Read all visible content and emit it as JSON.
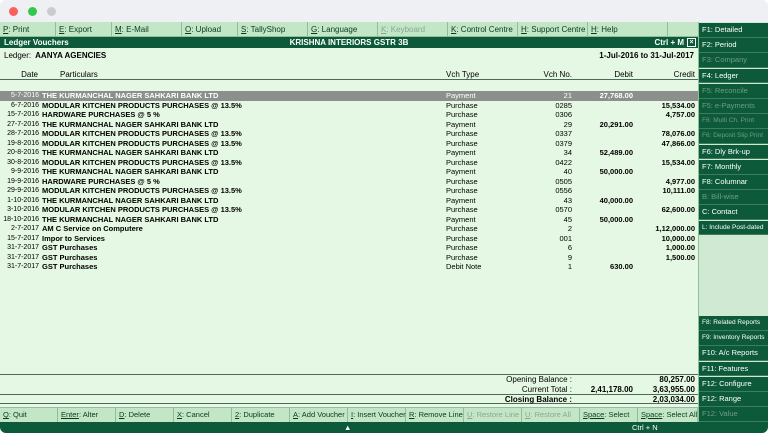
{
  "topbar": [
    {
      "key": "P",
      "label": ": Print",
      "w": 56,
      "disabled": false
    },
    {
      "key": "E",
      "label": ": Export",
      "w": 56,
      "disabled": false
    },
    {
      "key": "M",
      "label": ": E-Mail",
      "w": 70,
      "disabled": false
    },
    {
      "key": "O",
      "label": ": Upload",
      "w": 56,
      "disabled": false
    },
    {
      "key": "S",
      "label": ": TallyShop",
      "w": 70,
      "disabled": false
    },
    {
      "key": "G",
      "label": ": Language",
      "w": 70,
      "disabled": false
    },
    {
      "key": "K",
      "label": ": Keyboard",
      "w": 70,
      "disabled": true
    },
    {
      "key": "K",
      "label": ": Control Centre",
      "w": 70,
      "disabled": false
    },
    {
      "key": "H",
      "label": ": Support Centre",
      "w": 70,
      "disabled": false
    },
    {
      "key": "H",
      "label": ": Help",
      "w": 80,
      "disabled": false
    }
  ],
  "header": {
    "left": "Ledger Vouchers",
    "center": "KRISHNA INTERIORS GSTR 3B",
    "right": "Ctrl + M",
    "close": "×"
  },
  "ledger": {
    "label": "Ledger:",
    "name": "AANYA AGENCIES",
    "period": "1-Jul-2016 to 31-Jul-2017"
  },
  "columns": {
    "date": "Date",
    "particulars": "Particulars",
    "vch_type": "Vch Type",
    "vch_no": "Vch No.",
    "debit": "Debit",
    "credit": "Credit"
  },
  "rows": [
    {
      "date": "5-7-2016",
      "particulars": "THE KURMANCHAL NAGER SAHKARI BANK LTD",
      "vch_type": "Payment",
      "vch_no": "21",
      "debit": "27,768.00",
      "credit": ""
    },
    {
      "date": "6-7-2016",
      "particulars": "MODULAR KITCHEN PRODUCTS PURCHASES @ 13.5%",
      "vch_type": "Purchase",
      "vch_no": "0285",
      "debit": "",
      "credit": "15,534.00"
    },
    {
      "date": "15-7-2016",
      "particulars": "HARDWARE PURCHASES @ 5 %",
      "vch_type": "Purchase",
      "vch_no": "0306",
      "debit": "",
      "credit": "4,757.00"
    },
    {
      "date": "27-7-2016",
      "particulars": "THE KURMANCHAL NAGER SAHKARI BANK LTD",
      "vch_type": "Payment",
      "vch_no": "29",
      "debit": "20,291.00",
      "credit": ""
    },
    {
      "date": "28-7-2016",
      "particulars": "MODULAR KITCHEN PRODUCTS PURCHASES @ 13.5%",
      "vch_type": "Purchase",
      "vch_no": "0337",
      "debit": "",
      "credit": "78,076.00"
    },
    {
      "date": "19-8-2016",
      "particulars": "MODULAR KITCHEN PRODUCTS PURCHASES @ 13.5%",
      "vch_type": "Purchase",
      "vch_no": "0379",
      "debit": "",
      "credit": "47,866.00"
    },
    {
      "date": "20-8-2016",
      "particulars": "THE KURMANCHAL NAGER SAHKARI BANK LTD",
      "vch_type": "Payment",
      "vch_no": "34",
      "debit": "52,489.00",
      "credit": ""
    },
    {
      "date": "30-8-2016",
      "particulars": "MODULAR KITCHEN PRODUCTS PURCHASES @ 13.5%",
      "vch_type": "Purchase",
      "vch_no": "0422",
      "debit": "",
      "credit": "15,534.00"
    },
    {
      "date": "9-9-2016",
      "particulars": "THE KURMANCHAL NAGER SAHKARI BANK LTD",
      "vch_type": "Payment",
      "vch_no": "40",
      "debit": "50,000.00",
      "credit": ""
    },
    {
      "date": "19-9-2016",
      "particulars": "HARDWARE PURCHASES @ 5 %",
      "vch_type": "Purchase",
      "vch_no": "0505",
      "debit": "",
      "credit": "4,977.00"
    },
    {
      "date": "29-9-2016",
      "particulars": "MODULAR KITCHEN PRODUCTS PURCHASES @ 13.5%",
      "vch_type": "Purchase",
      "vch_no": "0556",
      "debit": "",
      "credit": "10,111.00"
    },
    {
      "date": "1-10-2016",
      "particulars": "THE KURMANCHAL NAGER SAHKARI BANK LTD",
      "vch_type": "Payment",
      "vch_no": "43",
      "debit": "40,000.00",
      "credit": ""
    },
    {
      "date": "3-10-2016",
      "particulars": "MODULAR KITCHEN PRODUCTS PURCHASES @ 13.5%",
      "vch_type": "Purchase",
      "vch_no": "0570",
      "debit": "",
      "credit": "62,600.00"
    },
    {
      "date": "18-10-2016",
      "particulars": "THE KURMANCHAL NAGER SAHKARI BANK LTD",
      "vch_type": "Payment",
      "vch_no": "45",
      "debit": "50,000.00",
      "credit": ""
    },
    {
      "date": "2-7-2017",
      "particulars": "AM C Service on Computere",
      "vch_type": "Purchase",
      "vch_no": "2",
      "debit": "",
      "credit": "1,12,000.00"
    },
    {
      "date": "15-7-2017",
      "particulars": "Impor to Services",
      "vch_type": "Purchase",
      "vch_no": "001",
      "debit": "",
      "credit": "10,000.00"
    },
    {
      "date": "31-7-2017",
      "particulars": "GST Purchases",
      "vch_type": "Purchase",
      "vch_no": "6",
      "debit": "",
      "credit": "1,000.00"
    },
    {
      "date": "31-7-2017",
      "particulars": "GST Purchases",
      "vch_type": "Purchase",
      "vch_no": "9",
      "debit": "",
      "credit": "1,500.00"
    },
    {
      "date": "31-7-2017",
      "particulars": "GST Purchases",
      "vch_type": "Debit Note",
      "vch_no": "1",
      "debit": "630.00",
      "credit": ""
    }
  ],
  "totals": {
    "opening_label": "Opening Balance :",
    "opening_credit": "80,257.00",
    "current_label": "Current Total :",
    "current_debit": "2,41,178.00",
    "current_credit": "3,63,955.00",
    "closing_label": "Closing Balance :",
    "closing_credit": "2,03,034.00"
  },
  "bottombar": [
    {
      "key": "Q",
      "label": ": Quit",
      "w": 58,
      "disabled": false
    },
    {
      "key": "Enter",
      "label": ": Alter",
      "w": 58,
      "disabled": false
    },
    {
      "key": "D",
      "label": ": Delete",
      "w": 58,
      "disabled": false
    },
    {
      "key": "X",
      "label": ": Cancel",
      "w": 58,
      "disabled": false
    },
    {
      "key": "2",
      "label": ": Duplicate",
      "w": 58,
      "disabled": false
    },
    {
      "key": "A",
      "label": ": Add Voucher",
      "w": 58,
      "disabled": false
    },
    {
      "key": "I",
      "label": ": Insert Voucher",
      "w": 58,
      "disabled": false
    },
    {
      "key": "R",
      "label": ": Remove Line",
      "w": 58,
      "disabled": false
    },
    {
      "key": "U",
      "label": ": Restore Line",
      "w": 58,
      "disabled": true
    },
    {
      "key": "U",
      "label": ": Restore All",
      "w": 58,
      "disabled": true
    },
    {
      "key": "Space",
      "label": ": Select",
      "w": 58,
      "disabled": false
    },
    {
      "key": "Space",
      "label": ": Select All",
      "w": 60,
      "disabled": false
    }
  ],
  "statusbar": {
    "chevron": "▲",
    "keys": "Ctrl + N"
  },
  "sidebar": [
    {
      "label": "F1: Detailed",
      "disabled": false,
      "small": false
    },
    {
      "label": "F2: Period",
      "disabled": false,
      "small": false
    },
    {
      "label": "F3: Company",
      "disabled": true,
      "small": false
    },
    {
      "label": "F4: Ledger",
      "disabled": false,
      "small": false
    },
    {
      "label": "F5: Reconcile",
      "disabled": true,
      "small": false
    },
    {
      "label": "F5: e-Payments",
      "disabled": true,
      "small": false
    },
    {
      "label": "F6: Multi Ch. Print",
      "disabled": true,
      "small": true
    },
    {
      "label": "F6: Deposit Slip Print",
      "disabled": true,
      "small": true
    },
    {
      "label": "F6: Dly Brk-up",
      "disabled": false,
      "small": false
    },
    {
      "label": "F7: Monthly",
      "disabled": false,
      "small": false
    },
    {
      "label": "F8: Columnar",
      "disabled": false,
      "small": false
    },
    {
      "label": "B: Bill-wise",
      "disabled": true,
      "small": false
    },
    {
      "label": "C: Contact",
      "disabled": false,
      "small": false
    },
    {
      "label": "L: Include Post-dated",
      "disabled": false,
      "small": true
    }
  ],
  "sidebar_bottom": [
    {
      "label": "F8: Related Reports",
      "disabled": false,
      "small": true
    },
    {
      "label": "F9: Inventory Reports",
      "disabled": false,
      "small": true
    },
    {
      "label": "F10: A/c Reports",
      "disabled": false,
      "small": false
    },
    {
      "label": "F11: Features",
      "disabled": false,
      "small": false
    },
    {
      "label": "F12: Configure",
      "disabled": false,
      "small": false
    },
    {
      "label": "F12: Range",
      "disabled": false,
      "small": false
    },
    {
      "label": "F12: Value",
      "disabled": true,
      "small": false
    }
  ]
}
